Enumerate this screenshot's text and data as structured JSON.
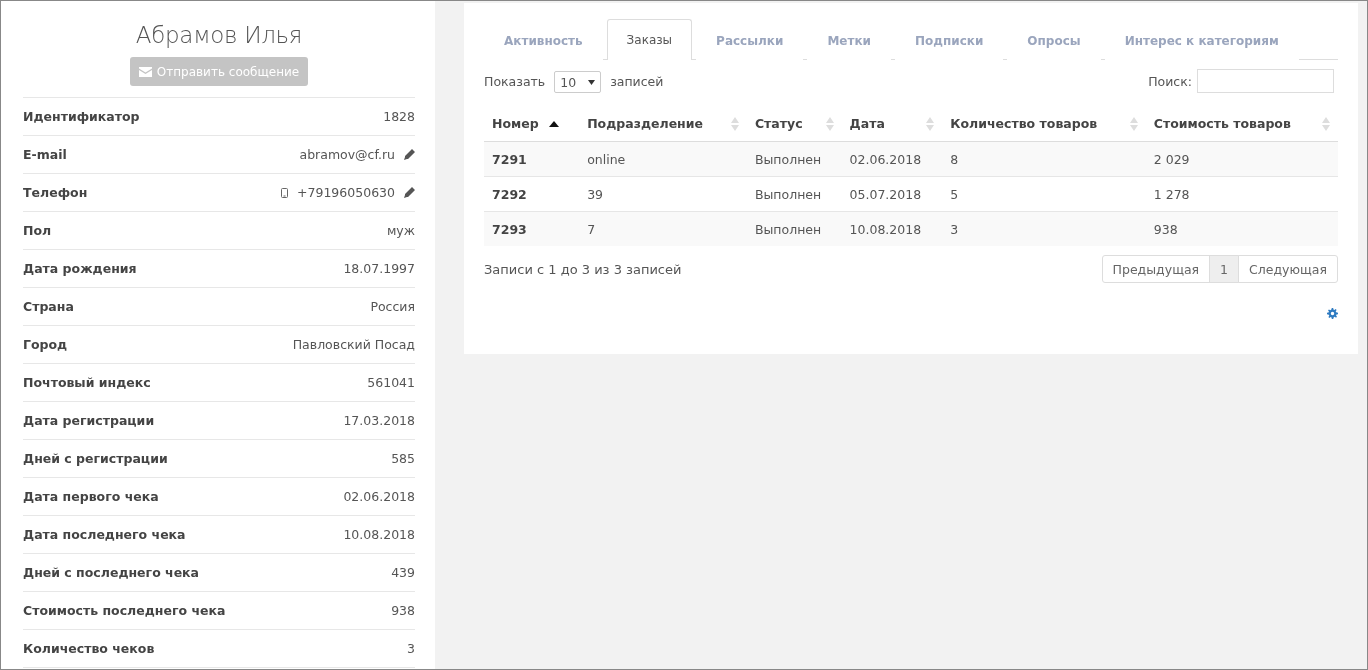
{
  "profile": {
    "name": "Абрамов Илья",
    "send_button": {
      "label": "Отправить сообщение",
      "disabled": true
    },
    "fields": [
      {
        "label": "Идентификатор",
        "value": "1828",
        "kind": "text",
        "editable": false
      },
      {
        "label": "E-mail",
        "value": "abramov@cf.ru",
        "kind": "text",
        "editable": true
      },
      {
        "label": "Телефон",
        "value": "+79196050630",
        "kind": "phone",
        "editable": true
      },
      {
        "label": "Пол",
        "value": "муж",
        "kind": "text",
        "editable": false
      },
      {
        "label": "Дата рождения",
        "value": "18.07.1997",
        "kind": "text",
        "editable": false
      },
      {
        "label": "Страна",
        "value": "Россия",
        "kind": "text",
        "editable": false
      },
      {
        "label": "Город",
        "value": "Павловский Посад",
        "kind": "text",
        "editable": false
      },
      {
        "label": "Почтовый индекс",
        "value": "561041",
        "kind": "text",
        "editable": false
      },
      {
        "label": "Дата регистрации",
        "value": "17.03.2018",
        "kind": "text",
        "editable": false
      },
      {
        "label": "Дней с регистрации",
        "value": "585",
        "kind": "text",
        "editable": false
      },
      {
        "label": "Дата первого чека",
        "value": "02.06.2018",
        "kind": "text",
        "editable": false
      },
      {
        "label": "Дата последнего чека",
        "value": "10.08.2018",
        "kind": "text",
        "editable": false
      },
      {
        "label": "Дней с последнего чека",
        "value": "439",
        "kind": "text",
        "editable": false
      },
      {
        "label": "Стоимость последнего чека",
        "value": "938",
        "kind": "text",
        "editable": false
      },
      {
        "label": "Количество чеков",
        "value": "3",
        "kind": "text",
        "editable": false
      }
    ]
  },
  "tabs": [
    {
      "label": "Активность",
      "selected": false
    },
    {
      "label": "Заказы",
      "selected": true
    },
    {
      "label": "Рассылки",
      "selected": false
    },
    {
      "label": "Метки",
      "selected": false
    },
    {
      "label": "Подписки",
      "selected": false
    },
    {
      "label": "Опросы",
      "selected": false
    },
    {
      "label": "Интерес к категориям",
      "selected": false
    }
  ],
  "length": {
    "before": "Показать",
    "value": "10",
    "after": "записей"
  },
  "search": {
    "label": "Поиск:"
  },
  "table": {
    "columns": [
      {
        "label": "Номер",
        "sorted": true
      },
      {
        "label": "Подразделение",
        "sorted": false
      },
      {
        "label": "Статус",
        "sorted": false
      },
      {
        "label": "Дата",
        "sorted": false
      },
      {
        "label": "Количество товаров",
        "sorted": false
      },
      {
        "label": "Стоимость товаров",
        "sorted": false
      }
    ],
    "rows": [
      [
        "7291",
        "online",
        "Выполнен",
        "02.06.2018",
        "8",
        "2 029"
      ],
      [
        "7292",
        "39",
        "Выполнен",
        "05.07.2018",
        "5",
        "1 278"
      ],
      [
        "7293",
        "7",
        "Выполнен",
        "10.08.2018",
        "3",
        "938"
      ]
    ]
  },
  "info": "Записи с 1 до 3 из 3 записей",
  "pagination": [
    {
      "label": "Предыдущая",
      "selected": false
    },
    {
      "label": "1",
      "selected": true
    },
    {
      "label": "Следующая",
      "selected": false
    }
  ]
}
